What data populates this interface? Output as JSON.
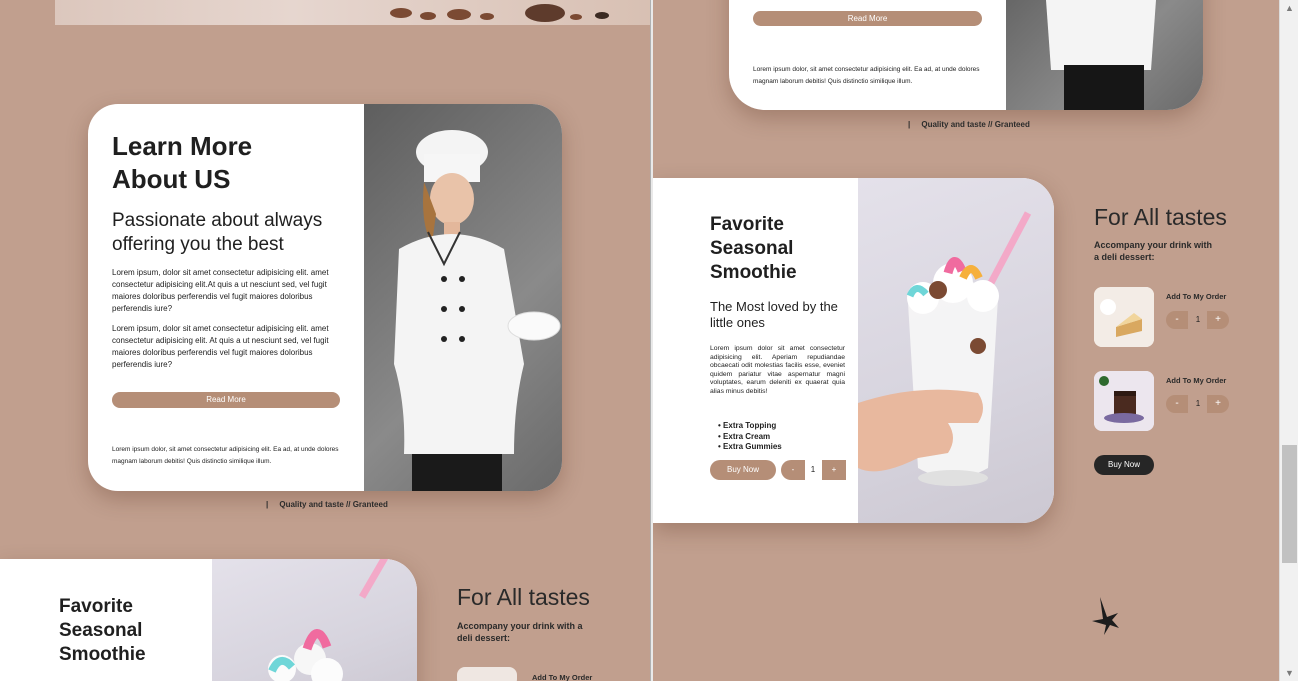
{
  "left": {
    "about": {
      "title_line1": "Learn More",
      "title_line2": "About US",
      "subtitle": "Passionate about always offering you the best",
      "para1": "Lorem ipsum, dolor sit amet consectetur adipisicing elit. amet consectetur adipisicing elit.At quis a ut nesciunt sed, vel fugit maiores doloribus perferendis vel fugit maiores doloribus perferendis iure?",
      "para2": "Lorem ipsum, dolor sit amet consectetur adipisicing elit. amet consectetur adipisicing elit. At quis a ut nesciunt sed, vel fugit maiores doloribus perferendis vel fugit maiores doloribus perferendis iure?",
      "read_more": "Read More",
      "footer_text": "Lorem ipsum dolor, sit amet consectetur adipisicing elit. Ea ad, at unde dolores magnam laborum debitis! Quis distinctio similique illum."
    },
    "quality": "Quality and taste // Granteed",
    "favorite": {
      "title": "Favorite Seasonal Smoothie"
    },
    "tastes": {
      "title": "For All tastes",
      "subtitle": "Accompany your drink with a deli dessert:",
      "add_label": "Add To My Order"
    }
  },
  "right": {
    "top_card": {
      "read_more": "Read More",
      "footer_text": "Lorem ipsum dolor, sit amet consectetur adipisicing elit. Ea ad, at unde dolores magnam laborum debitis! Quis distinctio similique illum."
    },
    "quality": "Quality and taste // Granteed",
    "favorite": {
      "title": "Favorite Seasonal Smoothie",
      "subtitle": "The Most loved by the little ones",
      "description": "Lorem ipsum dolor sit amet consectetur adipisicing elit. Aperiam repudiandae obcaecati odit molestias facilis esse, eveniet quidem pariatur vitae aspernatur magni voluptates, earum deleniti ex quaerat quia alias minus debitis!",
      "extras": [
        "Extra Topping",
        "Extra Cream",
        "Extra Gummies"
      ],
      "buy_now": "Buy Now",
      "minus": "-",
      "qty": "1",
      "plus": "+"
    },
    "tastes": {
      "title": "For All tastes",
      "subtitle": "Accompany your drink with a deli dessert:",
      "items": [
        {
          "add_label": "Add To My Order",
          "minus": "-",
          "qty": "1",
          "plus": "+"
        },
        {
          "add_label": "Add To My Order",
          "minus": "-",
          "qty": "1",
          "plus": "+"
        }
      ],
      "buy_now": "Buy Now"
    }
  },
  "scrollbar": {
    "up": "▲",
    "down": "▼"
  },
  "colors": {
    "background": "#c19f8e",
    "accent": "#b58e77",
    "dark_button": "#262626"
  }
}
